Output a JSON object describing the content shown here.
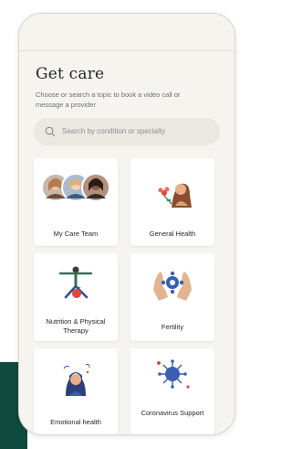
{
  "header": {
    "title": "Get care",
    "subtitle": "Choose or search a topic to book a video call or message a provider"
  },
  "search": {
    "placeholder": "Search by condition or specialty",
    "icon": "search-icon"
  },
  "topics": [
    {
      "label": "My Care Team",
      "icon": "care-team-avatars"
    },
    {
      "label": "General Health",
      "icon": "woman-with-flower-illustration"
    },
    {
      "label": "Nutrition & Physical Therapy",
      "icon": "yoga-pose-illustration"
    },
    {
      "label": "Fertility",
      "icon": "hands-holding-cell-illustration"
    },
    {
      "label": "Emotional health",
      "icon": "woman-with-swirls-illustration"
    },
    {
      "label": "Coronavirus Support",
      "icon": "virus-illustration"
    }
  ],
  "colors": {
    "brand_green": "#0f4a3e",
    "screen_background": "#f6f4ef",
    "card_background": "#ffffff",
    "search_background": "#ebe8e2",
    "accent_red": "#e0473f",
    "accent_blue": "#3a5fb0"
  }
}
